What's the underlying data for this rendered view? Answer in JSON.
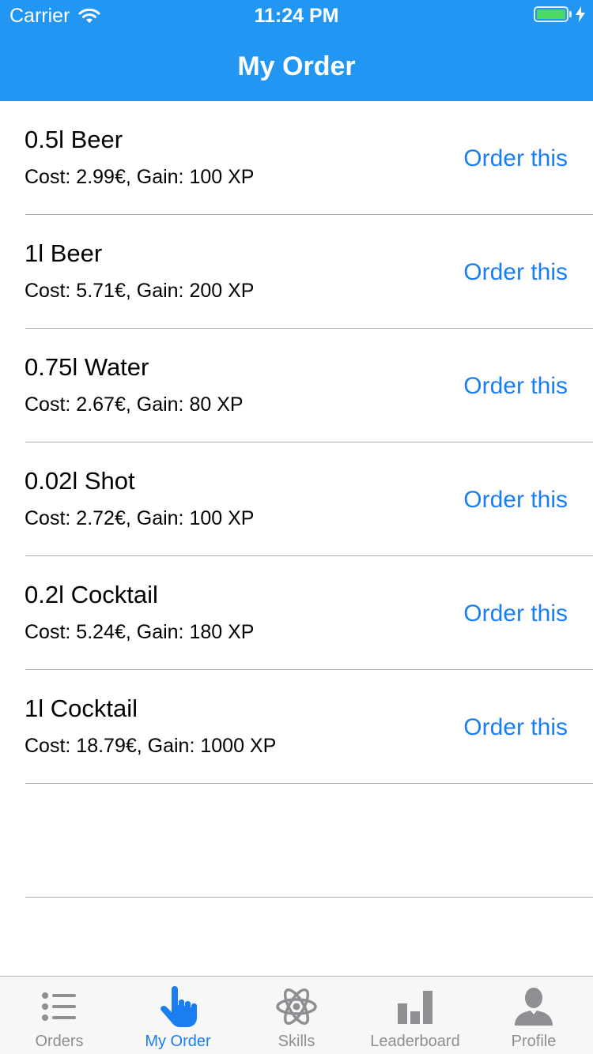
{
  "status_bar": {
    "carrier": "Carrier",
    "time": "11:24 PM",
    "battery_color": "#4cd964"
  },
  "nav": {
    "title": "My Order",
    "background": "#2196f3"
  },
  "items": [
    {
      "title": "0.5l Beer",
      "subtitle": "Cost: 2.99€, Gain: 100 XP",
      "action": "Order this"
    },
    {
      "title": "1l Beer",
      "subtitle": "Cost: 5.71€, Gain: 200 XP",
      "action": "Order this"
    },
    {
      "title": "0.75l Water",
      "subtitle": "Cost: 2.67€, Gain: 80 XP",
      "action": "Order this"
    },
    {
      "title": "0.02l Shot",
      "subtitle": "Cost: 2.72€, Gain: 100 XP",
      "action": "Order this"
    },
    {
      "title": "0.2l Cocktail",
      "subtitle": "Cost: 5.24€, Gain: 180 XP",
      "action": "Order this"
    },
    {
      "title": "1l Cocktail",
      "subtitle": "Cost: 18.79€, Gain: 1000 XP",
      "action": "Order this"
    }
  ],
  "tabbar": {
    "active_color": "#1a7ef0",
    "inactive_color": "#8e8e93",
    "tabs": [
      {
        "label": "Orders",
        "icon": "list-icon",
        "active": false
      },
      {
        "label": "My Order",
        "icon": "hand-pointer-icon",
        "active": true
      },
      {
        "label": "Skills",
        "icon": "atom-icon",
        "active": false
      },
      {
        "label": "Leaderboard",
        "icon": "bar-chart-icon",
        "active": false
      },
      {
        "label": "Profile",
        "icon": "person-icon",
        "active": false
      }
    ]
  }
}
